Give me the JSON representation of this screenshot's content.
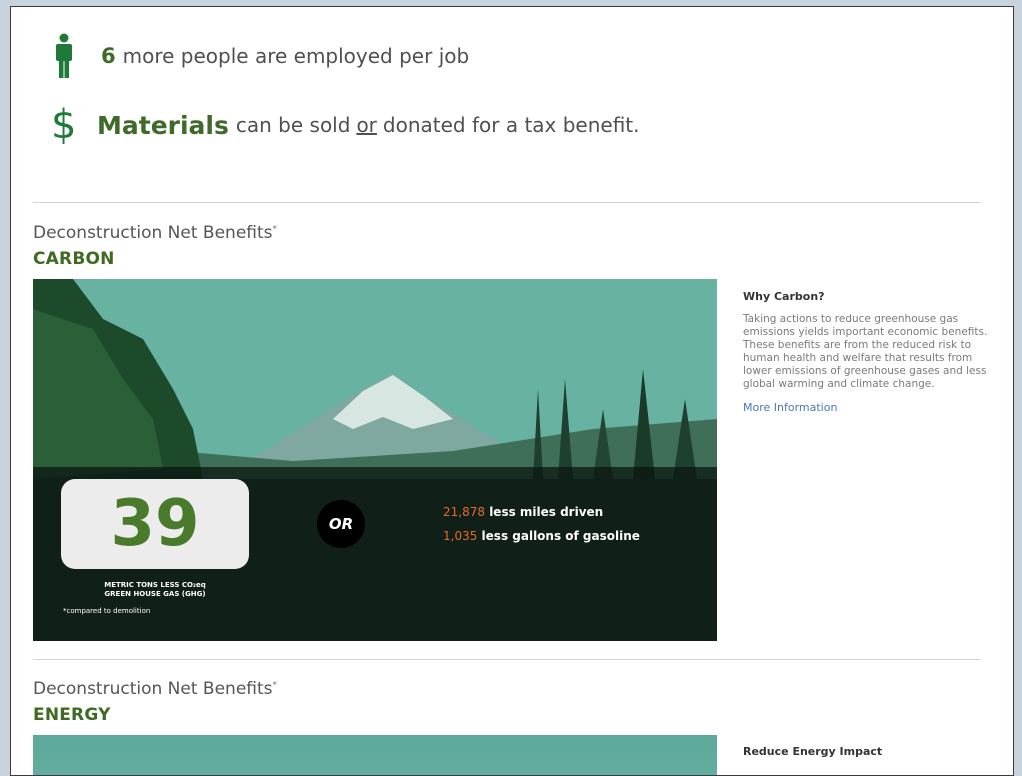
{
  "stats": {
    "people": {
      "value": "6",
      "text": "more people are employed per job"
    },
    "materials": {
      "bold": "Materials",
      "text_before": "can be sold",
      "or": "or",
      "text_after": "donated for a tax benefit."
    }
  },
  "carbon": {
    "title": "Deconstruction Net Benefits",
    "title_mark": "*",
    "subtitle": "CARBON",
    "metric_value": "39",
    "metric_caption_line1": "METRIC TONS LESS CO₂eq",
    "metric_caption_line2": "GREEN HOUSE GAS (GHG)",
    "footnote": "*compared to demolition",
    "or_label": "OR",
    "miles_value": "21,878",
    "miles_text": "less miles driven",
    "gas_value": "1,035",
    "gas_text": "less gallons of gasoline",
    "side_title": "Why Carbon?",
    "side_body": "Taking actions to reduce greenhouse gas emissions yields important economic benefits. These benefits are from the reduced risk to human health and welfare that results from lower emissions of greenhouse gases and less global warming and climate change.",
    "side_link": "More Information"
  },
  "energy": {
    "title": "Deconstruction Net Benefits",
    "title_mark": "*",
    "subtitle": "ENERGY",
    "side_title": "Reduce Energy Impact"
  },
  "colors": {
    "accent_green": "#3e6b22",
    "icon_green": "#1f7a3a",
    "highlight_orange": "#e46a2a",
    "link_blue": "#4a78b8"
  },
  "icons": [
    "person-icon",
    "dollar-icon"
  ]
}
